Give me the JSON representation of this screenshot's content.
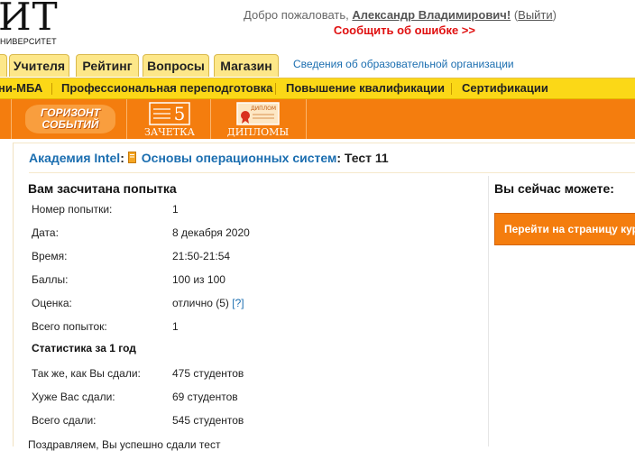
{
  "header": {
    "logo_big": "ИТ",
    "logo_small": "НИВЕРСИТЕТ",
    "welcome_prefix": "Добро пожаловать,",
    "user_name": "Александр Владимирович!",
    "logout_open": "(",
    "logout_label": "Выйти",
    "logout_close": ")",
    "report_error": "Сообщить об ошибке >>"
  },
  "tabs": [
    {
      "label": "Учителя"
    },
    {
      "label": "Рейтинг"
    },
    {
      "label": "Вопросы"
    },
    {
      "label": "Магазин"
    }
  ],
  "org_link": "Сведения об образовательной организации",
  "yellow_nav": [
    {
      "label": "ни-МБА"
    },
    {
      "label": "Профессиональная переподготовка"
    },
    {
      "label": "Повышение квалификации"
    },
    {
      "label": "Сертификации"
    }
  ],
  "orange_bar": {
    "horizon_line1": "ГОРИЗОНТ",
    "horizon_line2": "СОБЫТИЙ",
    "zachetka_number": "5",
    "zachetka_label": "ЗАЧЕТКА",
    "diplomas_label": "ДИПЛОМЫ",
    "diploma_icon_text": "ДИПЛОМ"
  },
  "breadcrumb": {
    "academy": "Академия Intel",
    "sep": ":",
    "course": "Основы операционных систем",
    "sep2": ":",
    "test": "Тест 11"
  },
  "attempt": {
    "title": "Вам засчитана попытка",
    "rows": [
      {
        "label": "Номер попытки:",
        "value": "1"
      },
      {
        "label": "Дата:",
        "value": "8 декабря 2020"
      },
      {
        "label": "Время:",
        "value": "21:50-21:54"
      },
      {
        "label": "Баллы:",
        "value": "100 из 100"
      },
      {
        "label": "Оценка:",
        "value": "отлично (5)",
        "help": "[?]"
      },
      {
        "label": "Всего попыток:",
        "value": "1"
      }
    ],
    "stats_title": "Статистика за 1 год",
    "stats_rows": [
      {
        "label": "Так же, как Вы сдали:",
        "value": "475 студентов"
      },
      {
        "label": "Хуже Вас сдали:",
        "value": "69 студентов"
      },
      {
        "label": "Всего сдали:",
        "value": "545 студентов"
      }
    ],
    "bottom_text": "Поздравляем, Вы успешно сдали тест"
  },
  "right_panel": {
    "title": "Вы сейчас можете:",
    "button_label": "Перейти на страницу курса"
  },
  "colors": {
    "orange": "#f47d0e",
    "yellow_nav": "#fbd817",
    "tab_bg": "#fde789",
    "link": "#1b6eb0",
    "error": "#e01010"
  }
}
